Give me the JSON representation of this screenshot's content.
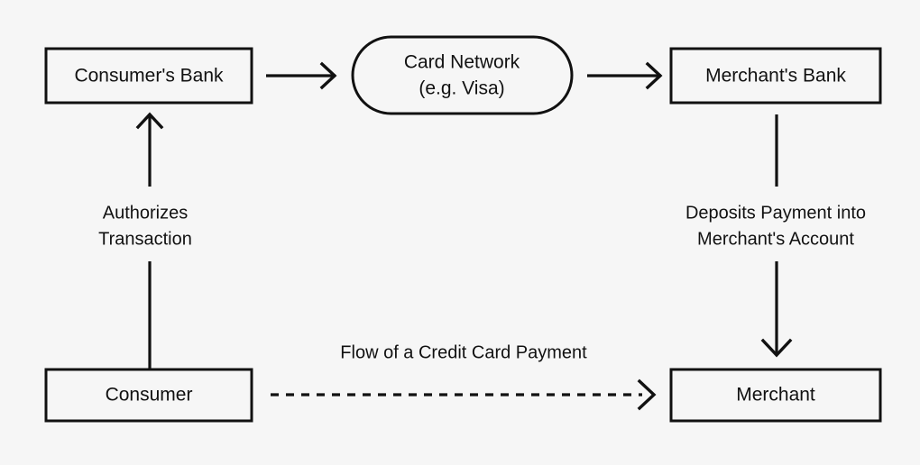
{
  "diagram": {
    "background_color": "#f6f6f6",
    "stroke_color": "#111111",
    "nodes": {
      "consumers_bank": {
        "label": "Consumer's Bank",
        "shape": "rectangle"
      },
      "card_network": {
        "label_line1": "Card Network",
        "label_line2": "(e.g. Visa)",
        "shape": "stadium"
      },
      "merchants_bank": {
        "label": "Merchant's Bank",
        "shape": "rectangle"
      },
      "consumer": {
        "label": "Consumer",
        "shape": "rectangle"
      },
      "merchant": {
        "label": "Merchant",
        "shape": "rectangle"
      }
    },
    "edges": {
      "bank_to_network": {
        "label": "",
        "style": "solid",
        "arrow": "open-chevron"
      },
      "network_to_merchant_bank": {
        "label": "",
        "style": "solid",
        "arrow": "open-chevron"
      },
      "consumer_to_consumers_bank": {
        "label_line1": "Authorizes",
        "label_line2": "Transaction",
        "style": "solid",
        "arrow": "open-chevron"
      },
      "merchant_bank_to_merchant": {
        "label_line1": "Deposits Payment into",
        "label_line2": "Merchant's Account",
        "style": "solid",
        "arrow": "open-chevron"
      },
      "consumer_to_merchant": {
        "label": "Flow of a Credit Card Payment",
        "style": "dashed",
        "arrow": "open-chevron"
      }
    }
  }
}
